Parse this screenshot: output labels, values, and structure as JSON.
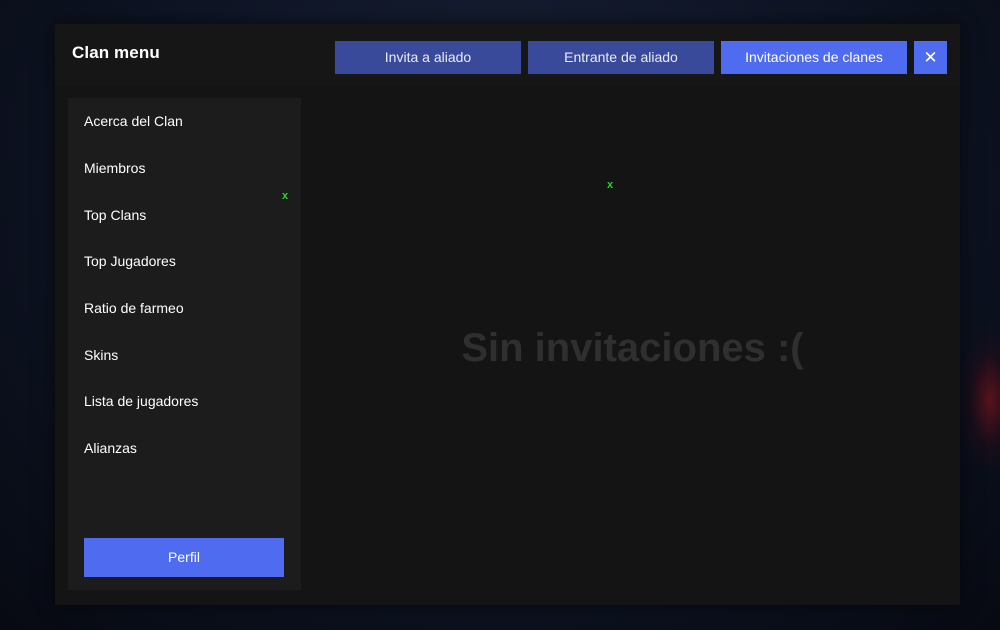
{
  "window": {
    "title": "Clan menu"
  },
  "tabs": [
    {
      "label": "Invita a aliado",
      "active": false
    },
    {
      "label": "Entrante de aliado",
      "active": false
    },
    {
      "label": "Invitaciones de clanes",
      "active": true
    }
  ],
  "close": {
    "label": "✕",
    "icon": "close-icon"
  },
  "sidebar": {
    "items": [
      {
        "label": "Acerca del Clan"
      },
      {
        "label": "Miembros"
      },
      {
        "label": "Top Clans"
      },
      {
        "label": "Top Jugadores"
      },
      {
        "label": "Ratio de farmeo"
      },
      {
        "label": "Skins"
      },
      {
        "label": "Lista de jugadores"
      },
      {
        "label": "Alianzas"
      }
    ],
    "profile_button": "Perfil"
  },
  "markers": [
    "x",
    "x"
  ],
  "main": {
    "empty_message": "Sin invitaciones :("
  },
  "colors": {
    "accent": "#4f6cf0",
    "accent_dim": "#3a4a9a",
    "panel": "#141414",
    "sidebar": "#1c1c1c",
    "marker": "#2fd02f",
    "empty_text": "#2f2f2f"
  }
}
